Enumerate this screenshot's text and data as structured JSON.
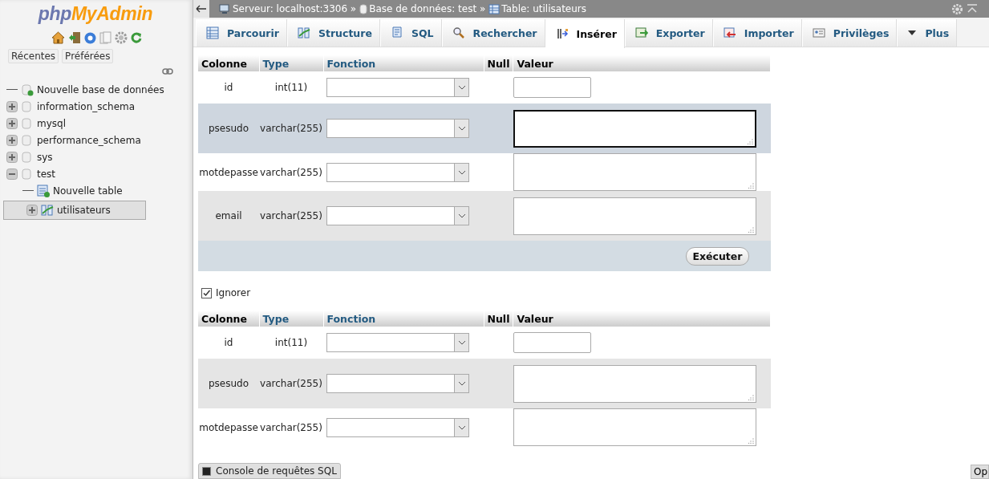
{
  "sidebar": {
    "logo": {
      "php": "php",
      "rest": "MyAdmin"
    },
    "tabs": [
      {
        "label": "Récentes"
      },
      {
        "label": "Préférées"
      }
    ],
    "tree": [
      {
        "label": "Nouvelle base de données",
        "kind": "new-db",
        "expandable": false,
        "selected": false
      },
      {
        "label": "information_schema",
        "kind": "db",
        "expandable": true,
        "expanded": false,
        "selected": false
      },
      {
        "label": "mysql",
        "kind": "db",
        "expandable": true,
        "expanded": false,
        "selected": false
      },
      {
        "label": "performance_schema",
        "kind": "db",
        "expandable": true,
        "expanded": false,
        "selected": false
      },
      {
        "label": "sys",
        "kind": "db",
        "expandable": true,
        "expanded": false,
        "selected": false
      },
      {
        "label": "test",
        "kind": "db",
        "expandable": true,
        "expanded": true,
        "selected": false,
        "children": [
          {
            "label": "Nouvelle table",
            "kind": "new-table",
            "expandable": false,
            "selected": false
          },
          {
            "label": "utilisateurs",
            "kind": "table",
            "expandable": true,
            "expanded": false,
            "selected": true
          }
        ]
      }
    ]
  },
  "breadcrumb": [
    {
      "kind": "server",
      "label": "Serveur: localhost:3306 »"
    },
    {
      "kind": "db",
      "label": "Base de données: test »"
    },
    {
      "kind": "table",
      "label": "Table: utilisateurs"
    }
  ],
  "tabs": [
    {
      "label": "Parcourir",
      "selected": false
    },
    {
      "label": "Structure",
      "selected": false
    },
    {
      "label": "SQL",
      "selected": false
    },
    {
      "label": "Rechercher",
      "selected": false
    },
    {
      "label": "Insérer",
      "selected": true
    },
    {
      "label": "Exporter",
      "selected": false
    },
    {
      "label": "Importer",
      "selected": false
    },
    {
      "label": "Privilèges",
      "selected": false
    },
    {
      "label": "Plus",
      "selected": false
    }
  ],
  "forms": [
    {
      "columns": [
        "Colonne",
        "Type",
        "Fonction",
        "Null",
        "Valeur"
      ],
      "rows": [
        {
          "name": "id",
          "type": "int(11)",
          "kind": "input",
          "highlighted": false
        },
        {
          "name": "psesudo",
          "type": "varchar(255)",
          "kind": "textarea",
          "highlighted": true
        },
        {
          "name": "motdepasse",
          "type": "varchar(255)",
          "kind": "textarea",
          "highlighted": false
        },
        {
          "name": "email",
          "type": "varchar(255)",
          "kind": "textarea",
          "highlighted": false
        }
      ],
      "submit": "Exécuter"
    },
    {
      "columns": [
        "Colonne",
        "Type",
        "Fonction",
        "Null",
        "Valeur"
      ],
      "rows": [
        {
          "name": "id",
          "type": "int(11)",
          "kind": "input",
          "highlighted": false
        },
        {
          "name": "psesudo",
          "type": "varchar(255)",
          "kind": "textarea",
          "highlighted": false
        },
        {
          "name": "motdepasse",
          "type": "varchar(255)",
          "kind": "textarea",
          "highlighted": false
        }
      ]
    }
  ],
  "ignore": {
    "label": "Ignorer",
    "checked": true
  },
  "console": {
    "label": "Console de requêtes SQL"
  },
  "corner_button": {
    "label": "Op"
  }
}
